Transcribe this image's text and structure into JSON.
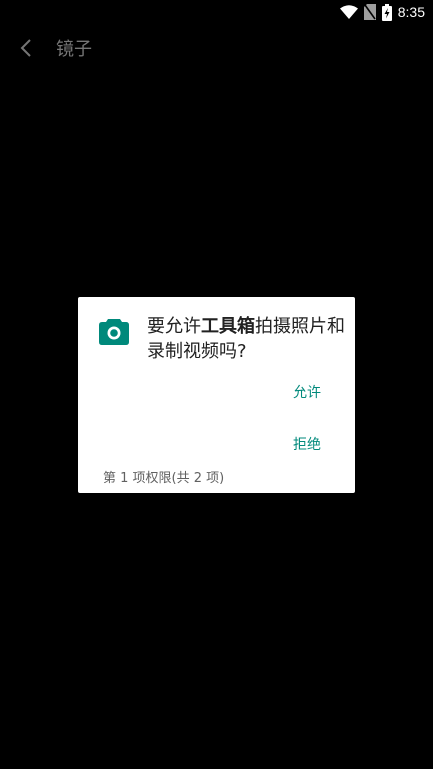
{
  "status_bar": {
    "time": "8:35",
    "icons": [
      "wifi-icon",
      "no-sim-icon",
      "battery-charging-icon"
    ]
  },
  "app_bar": {
    "back_icon": "chevron-left-icon",
    "title": "镜子"
  },
  "dialog": {
    "icon": "camera-icon",
    "message_prefix": "要允许",
    "app_name": "工具箱",
    "message_suffix": "拍摄照片和录制视频吗?",
    "allow_label": "允许",
    "deny_label": "拒绝",
    "permission_counter": "第 1 项权限(共 2 项)"
  },
  "colors": {
    "background": "#000000",
    "dialog_background": "#ffffff",
    "accent": "#00897b",
    "title_text": "#757575"
  }
}
